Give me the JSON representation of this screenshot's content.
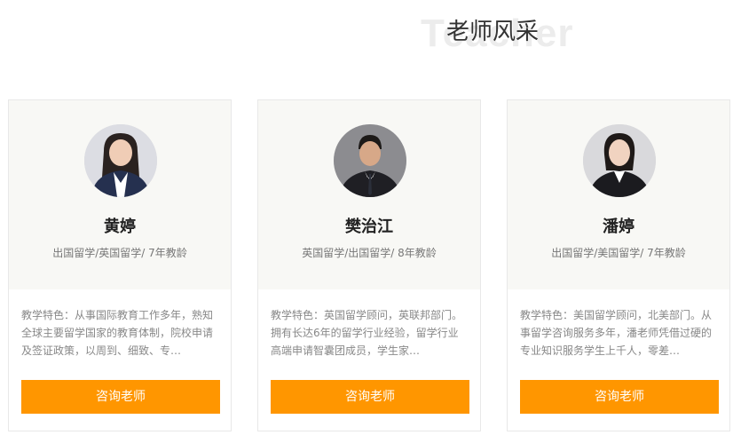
{
  "section": {
    "title": "老师风采",
    "bg_title": "Teacher"
  },
  "colors": {
    "button": "#ff9600",
    "card_top": "#f8f8f5"
  },
  "teachers": [
    {
      "name": "黄婷",
      "tags": "出国留学/英国留学/ 7年教龄",
      "desc": "教学特色：从事国际教育工作多年，熟知全球主要留学国家的教育体制，院校申请及签证政策，以周到、细致、专…",
      "button": "咨询老师"
    },
    {
      "name": "樊治江",
      "tags": "英国留学/出国留学/ 8年教龄",
      "desc": "教学特色：英国留学顾问，英联邦部门。 拥有长达6年的留学行业经验，留学行业高端申请智囊团成员，学生家…",
      "button": "咨询老师"
    },
    {
      "name": "潘婷",
      "tags": "出国留学/美国留学/ 7年教龄",
      "desc": "教学特色：美国留学顾问，北美部门。从事留学咨询服务多年，潘老师凭借过硬的专业知识服务学生上千人，零差…",
      "button": "咨询老师"
    }
  ]
}
